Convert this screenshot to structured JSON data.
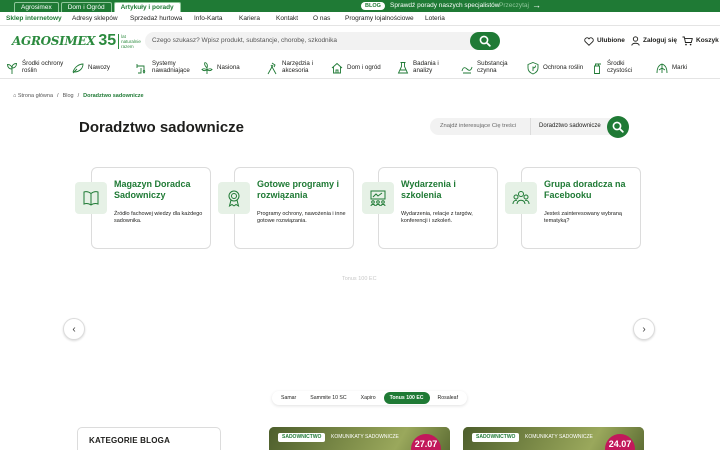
{
  "top_tabs": [
    "Agrosimex",
    "Dom i Ogród",
    "Artykuły i porady"
  ],
  "top_blog_badge": "BLOG",
  "top_promo": "Sprawdź porady naszych specjalistów",
  "top_promo_link": "Przeczytaj",
  "subnav": [
    "Sklep internetowy",
    "Adresy sklepów",
    "Sprzedaż hurtowa",
    "Info-Karta",
    "Kariera",
    "Kontakt",
    "O nas",
    "Programy lojalnościowe",
    "Loteria"
  ],
  "logo": {
    "word": "AGROSIMEX",
    "num": "35",
    "tag": "lat naturalnie razem"
  },
  "search_placeholder": "Czego szukasz? Wpisz produkt, substancje, chorobę, szkodnika",
  "header_links": {
    "favorites": "Ulubione",
    "login": "Zaloguj się",
    "cart": "Koszyk"
  },
  "categories": [
    "Środki ochrony roślin",
    "Nawozy",
    "Systemy nawadniające",
    "Nasiona",
    "Narzędzia i akcesoria",
    "Dom i ogród",
    "Badania i analizy",
    "Substancja czynna",
    "Ochrona roślin",
    "Środki czystości",
    "Marki"
  ],
  "breadcrumb": {
    "home": "Strona główna",
    "blog": "Blog",
    "current": "Doradztwo sadownicze"
  },
  "page_title": "Doradztwo sadownicze",
  "blog_search": {
    "placeholder": "Znajdź interesujące Cię treści",
    "selected": "Doradztwo sadownicze"
  },
  "cards": [
    {
      "title": "Magazyn Doradca Sadowniczy",
      "desc": "Źródło fachowej wiedzy dla każdego sadownika."
    },
    {
      "title": "Gotowe programy i rozwiązania",
      "desc": "Programy ochrony, nawożenia i inne gotowe rozwiązania."
    },
    {
      "title": "Wydarzenia i szkolenia",
      "desc": "Wydarzenia, relacje z targów, konferencji i szkoleń."
    },
    {
      "title": "Grupa doradcza na Facebooku",
      "desc": "Jesteś zainteresowany wybraną tematyką?"
    }
  ],
  "ghost_text": "Tonus 100 EC",
  "pills": [
    "Samar",
    "Sammite 10 SC",
    "Xapiro",
    "Tonus 100 EC",
    "Rosaleaf"
  ],
  "pill_active": "Tonus 100 EC",
  "category_box": "KATEGORIE BLOGA",
  "posts": [
    {
      "badge1": "SADOWNICTWO",
      "badge2": "KOMUNIKATY SADOWNICZE",
      "date": "27.07"
    },
    {
      "badge1": "SADOWNICTWO",
      "badge2": "KOMUNIKATY SADOWNICZE",
      "date": "24.07"
    }
  ],
  "colors": {
    "brand": "#1f7a35",
    "accent_pink": "#c2185b"
  }
}
